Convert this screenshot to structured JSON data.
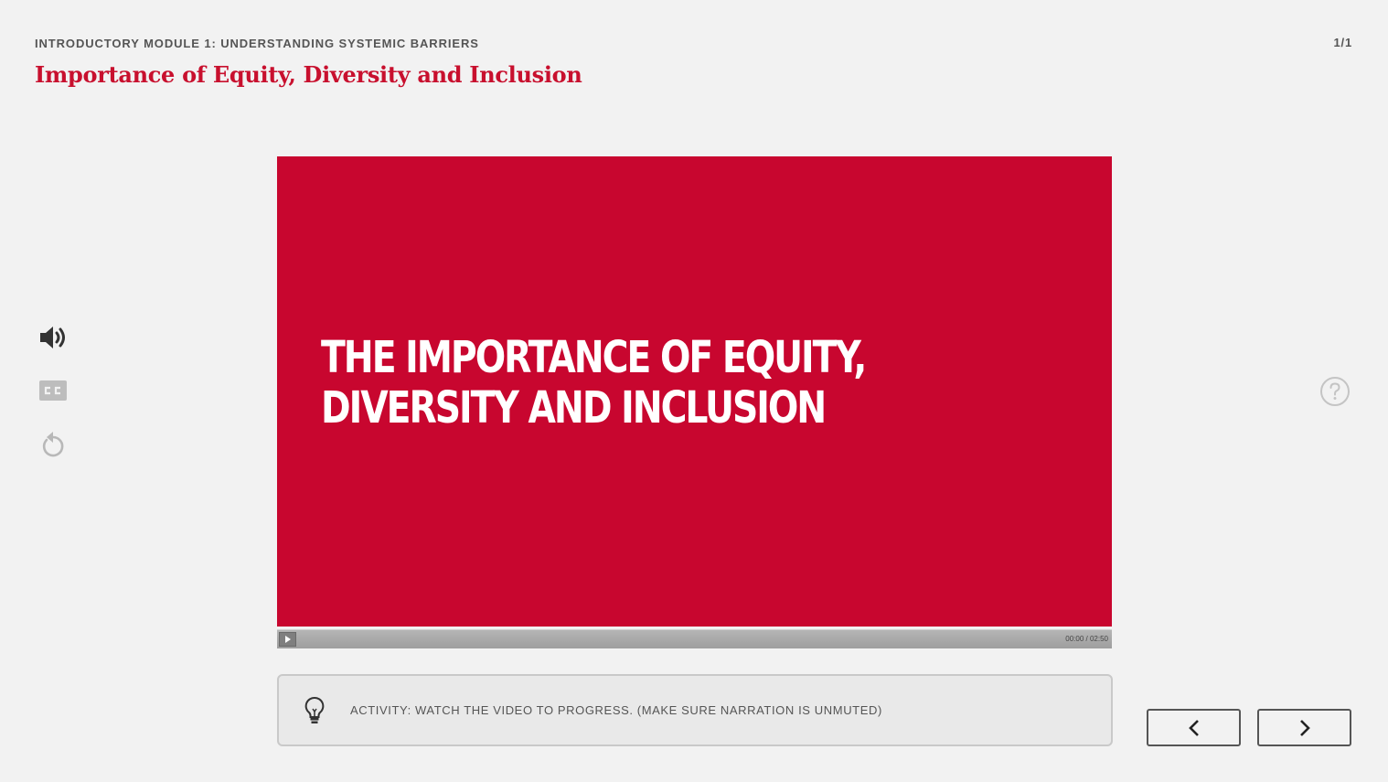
{
  "header": {
    "module_label": "INTRODUCTORY MODULE 1: UNDERSTANDING SYSTEMIC BARRIERS",
    "title": "Importance of Equity, Diversity and Inclusion",
    "page_counter": "1/1"
  },
  "tools": {
    "audio_icon": "speaker-icon",
    "captions_icon": "closed-captions-icon",
    "replay_icon": "replay-icon",
    "help_icon": "help-icon"
  },
  "video": {
    "slide_text": "THE IMPORTANCE OF EQUITY,\nDIVERSITY AND INCLUSION",
    "time": "00:00 / 02:50",
    "progress": 0
  },
  "activity": {
    "icon": "lightbulb-icon",
    "text": "ACTIVITY: WATCH THE VIDEO TO PROGRESS. (MAKE SURE NARRATION IS UNMUTED)"
  },
  "navigation": {
    "prev_icon": "chevron-left-icon",
    "next_icon": "chevron-right-icon"
  },
  "colors": {
    "accent": "#c8102e",
    "video_background": "#c8062f",
    "page_background": "#f2f2f2"
  }
}
